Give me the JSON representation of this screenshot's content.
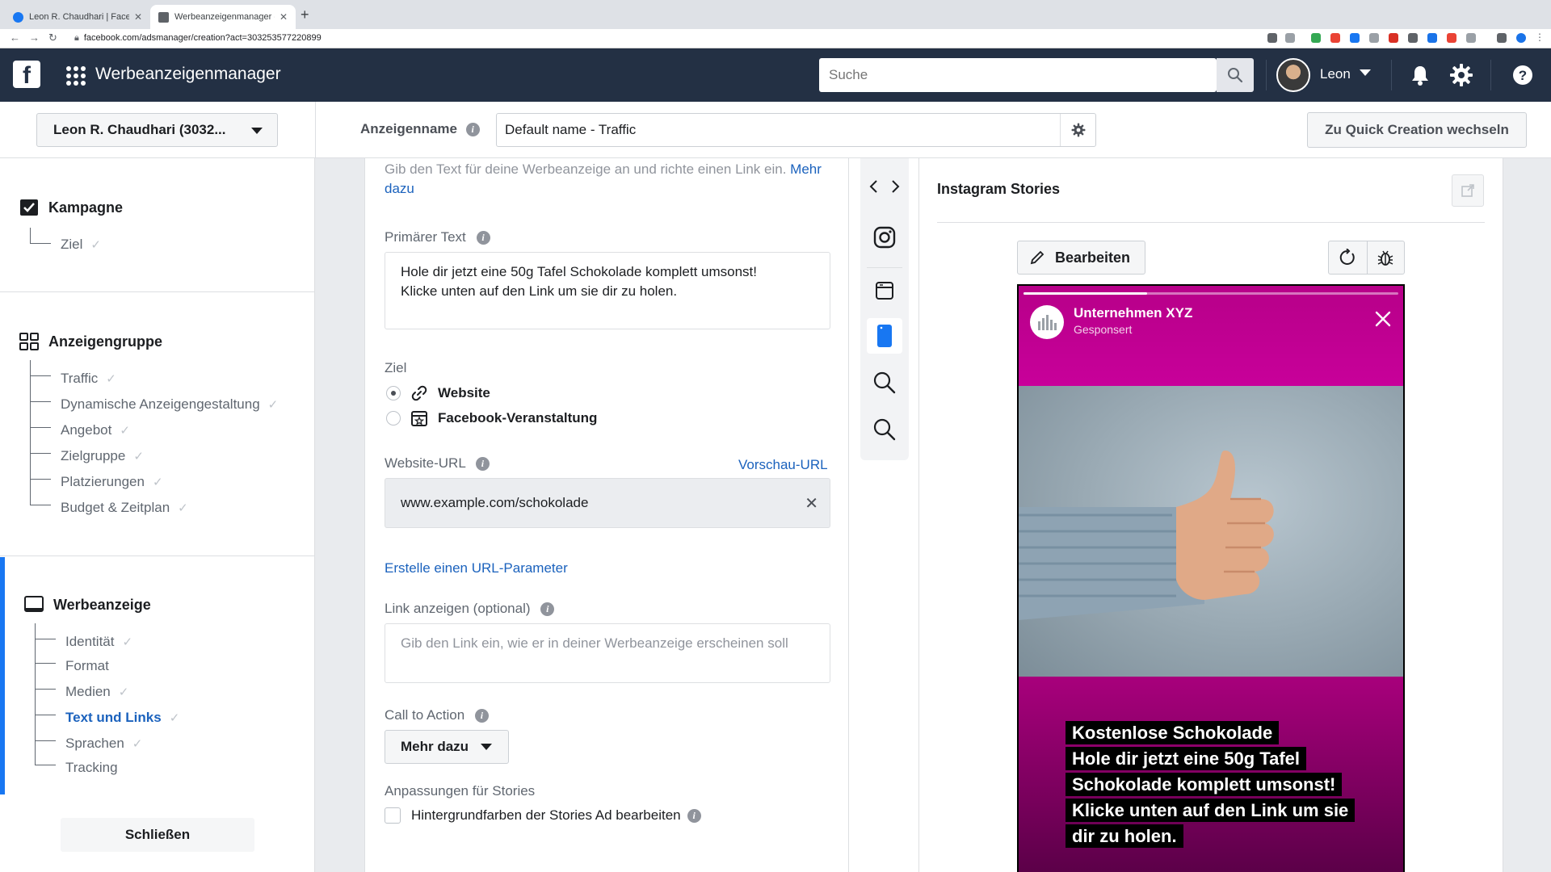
{
  "browser": {
    "tabs": [
      {
        "title": "Leon R. Chaudhari | Facebook",
        "active": false
      },
      {
        "title": "Werbeanzeigenmanager - Cre…",
        "active": true
      }
    ],
    "url": "facebook.com/adsmanager/creation?act=303253577220899"
  },
  "topbar": {
    "app_title": "Werbeanzeigenmanager",
    "search_placeholder": "Suche",
    "user_name": "Leon"
  },
  "subheader": {
    "account": "Leon R. Chaudhari (3032...",
    "adname_label": "Anzeigenname",
    "adname_value": "Default name - Traffic",
    "quick_creation": "Zu Quick Creation wechseln"
  },
  "sidebar": {
    "sections": [
      {
        "title": "Kampagne",
        "items": [
          {
            "label": "Ziel",
            "done": true
          }
        ]
      },
      {
        "title": "Anzeigengruppe",
        "items": [
          {
            "label": "Traffic",
            "done": true
          },
          {
            "label": "Dynamische Anzeigengestaltung",
            "done": true
          },
          {
            "label": "Angebot",
            "done": true
          },
          {
            "label": "Zielgruppe",
            "done": true
          },
          {
            "label": "Platzierungen",
            "done": true
          },
          {
            "label": "Budget & Zeitplan",
            "done": true
          }
        ]
      },
      {
        "title": "Werbeanzeige",
        "items": [
          {
            "label": "Identität",
            "done": true
          },
          {
            "label": "Format",
            "done": false
          },
          {
            "label": "Medien",
            "done": true
          },
          {
            "label": "Text und Links",
            "done": true,
            "active": true
          },
          {
            "label": "Sprachen",
            "done": true
          },
          {
            "label": "Tracking",
            "done": false
          }
        ]
      }
    ],
    "close_label": "Schließen",
    "check": "✓"
  },
  "form": {
    "intro_text": "Gib den Text für deine Werbeanzeige an und richte einen Link ein.",
    "intro_link": "Mehr dazu",
    "primary_text_label": "Primärer Text",
    "primary_text_line1": "Hole dir jetzt eine 50g Tafel Schokolade komplett umsonst!",
    "primary_text_line2": "Klicke unten auf den Link um sie dir zu holen.",
    "goal_label": "Ziel",
    "goal_options": [
      {
        "label": "Website",
        "selected": true
      },
      {
        "label": "Facebook-Veranstaltung",
        "selected": false
      }
    ],
    "website_url_label": "Website-URL",
    "preview_url_link": "Vorschau-URL",
    "website_url_value": "www.example.com/schokolade",
    "url_param_link": "Erstelle einen URL-Parameter",
    "display_link_label": "Link anzeigen",
    "display_link_optional": "(optional)",
    "display_link_placeholder": "Gib den Link ein, wie er in deiner Werbeanzeige erscheinen soll",
    "cta_label": "Call to Action",
    "cta_value": "Mehr dazu",
    "stories_label": "Anpassungen für Stories",
    "stories_checkbox": "Hintergrundfarben der Stories Ad bearbeiten"
  },
  "placements": {
    "items": [
      "instagram-icon",
      "feed-icon",
      "stories-icon",
      "search-icon",
      "search-results-icon"
    ],
    "selected_index": 2
  },
  "preview": {
    "title": "Instagram Stories",
    "edit_label": "Bearbeiten",
    "story": {
      "brand_name": "Unternehmen XYZ",
      "sponsored": "Gesponsert",
      "progress": 0.33,
      "caption_lines": [
        "Kostenlose Schokolade",
        "Hole dir jetzt eine 50g Tafel",
        "Schokolade komplett umsonst!",
        "Klicke unten auf den Link um sie",
        "dir zu holen."
      ]
    }
  },
  "colors": {
    "fb_topbar": "#233044",
    "link_blue": "#1b62bd",
    "accent_blue": "#1877f2",
    "story_magenta": "#c4008f"
  }
}
